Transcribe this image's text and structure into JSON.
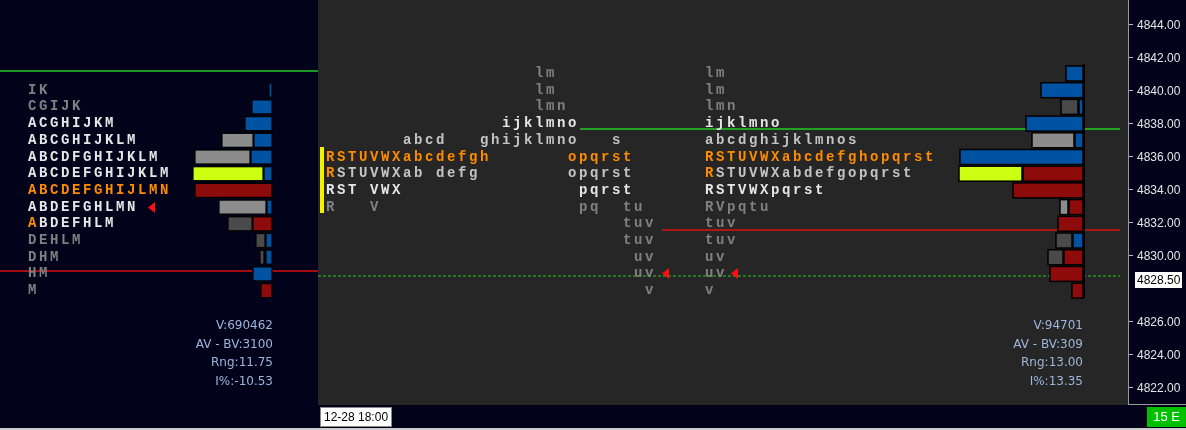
{
  "history_profile": {
    "rows": [
      {
        "parts": [
          {
            "text": "IK",
            "color": "#808080"
          }
        ],
        "marker": false
      },
      {
        "parts": [
          {
            "text": "CGIJK",
            "color": "#808080"
          }
        ],
        "marker": false
      },
      {
        "parts": [
          {
            "text": "ACGHIJKM",
            "color": "#e6e6e6"
          }
        ],
        "marker": false
      },
      {
        "parts": [
          {
            "text": "ABCGHIJKLM",
            "color": "#e6e6e6"
          }
        ],
        "marker": false
      },
      {
        "parts": [
          {
            "text": "ABCDFGHIJKLM",
            "color": "#e6e6e6"
          }
        ],
        "marker": false
      },
      {
        "parts": [
          {
            "text": "ABCDEFGHIJKLM",
            "color": "#e6e6e6"
          }
        ],
        "marker": false
      },
      {
        "parts": [
          {
            "text": "ABCDEFGHIJLMN",
            "color": "#ff8c00"
          }
        ],
        "marker": false
      },
      {
        "parts": [
          {
            "text": "ABDEFGHLMN",
            "color": "#e6e6e6"
          }
        ],
        "marker": true
      },
      {
        "parts": [
          {
            "text": "A",
            "color": "#ff8c00"
          },
          {
            "text": "BDEFHLM",
            "color": "#e6e6e6"
          }
        ],
        "marker": false
      },
      {
        "parts": [
          {
            "text": "DEHLM",
            "color": "#808080"
          }
        ],
        "marker": false
      },
      {
        "parts": [
          {
            "text": "DHM",
            "color": "#808080"
          }
        ],
        "marker": false
      },
      {
        "parts": [
          {
            "text": "HM",
            "color": "#808080"
          }
        ],
        "marker": false
      },
      {
        "parts": [
          {
            "text": "M",
            "color": "#808080"
          }
        ],
        "marker": false
      }
    ],
    "stats": [
      "V:690462",
      "AV - BV:3100",
      "Rng:11.75",
      "I%:-10.53"
    ]
  },
  "session_profile": {
    "rows": [
      {
        "cells": [
          {
            "parts": [
              {
                "text": "lm",
                "color": "#808080"
              }
            ]
          }
        ],
        "marker": false
      },
      {
        "cells": [
          {
            "parts": [
              {
                "text": "lm",
                "color": "#808080"
              }
            ]
          }
        ],
        "marker": false
      },
      {
        "cells": [
          {
            "parts": [
              {
                "text": "lmn",
                "color": "#808080"
              }
            ]
          }
        ],
        "marker": false
      },
      {
        "cells": [
          {
            "parts": [
              {
                "text": "ijklmno",
                "color": "#e6e6e6"
              }
            ]
          }
        ],
        "marker": false
      },
      {
        "cells": [
          {
            "parts": [
              {
                "text": "abcd",
                "color": "#c4c4c4"
              }
            ]
          },
          {
            "parts": [
              {
                "text": "ghijklmno",
                "color": "#c4c4c4"
              }
            ]
          },
          {
            "parts": [
              {
                "text": "s",
                "color": "#c4c4c4"
              }
            ]
          }
        ],
        "marker": false
      },
      {
        "cells": [
          {
            "parts": [
              {
                "text": "RSTUVWXabcdefgh",
                "color": "#ff8c00"
              }
            ]
          },
          {
            "parts": [
              {
                "text": "opqrst",
                "color": "#ff8c00"
              }
            ]
          }
        ],
        "marker": false
      },
      {
        "cells": [
          {
            "parts": [
              {
                "text": "R",
                "color": "#ff8c00"
              },
              {
                "text": "STUVWXab",
                "color": "#c4c4c4"
              }
            ]
          },
          {
            "parts": [
              {
                "text": "defg",
                "color": "#c4c4c4"
              }
            ]
          },
          {
            "parts": [
              {
                "text": "opqrst",
                "color": "#c4c4c4"
              }
            ]
          }
        ],
        "marker": false
      },
      {
        "cells": [
          {
            "parts": [
              {
                "text": "RST",
                "color": "#e6e6e6"
              }
            ]
          },
          {
            "parts": [
              {
                "text": "VWX",
                "color": "#e6e6e6"
              }
            ]
          },
          {
            "parts": [
              {
                "text": "pqrst",
                "color": "#e6e6e6"
              }
            ]
          }
        ],
        "marker": false
      },
      {
        "cells": [
          {
            "parts": [
              {
                "text": "R",
                "color": "#808080"
              }
            ]
          },
          {
            "parts": [
              {
                "text": "V",
                "color": "#808080"
              }
            ]
          },
          {
            "parts": [
              {
                "text": "pq",
                "color": "#808080"
              }
            ]
          },
          {
            "parts": [
              {
                "text": "tu",
                "color": "#808080"
              }
            ]
          }
        ],
        "marker": false
      },
      {
        "cells": [
          {
            "parts": [
              {
                "text": "tuv",
                "color": "#808080"
              }
            ]
          }
        ],
        "marker": false
      },
      {
        "cells": [
          {
            "parts": [
              {
                "text": "tuv",
                "color": "#808080"
              }
            ]
          }
        ],
        "marker": false
      },
      {
        "cells": [
          {
            "parts": [
              {
                "text": "uv",
                "color": "#808080"
              }
            ]
          }
        ],
        "marker": false
      },
      {
        "cells": [
          {
            "parts": [
              {
                "text": "uv",
                "color": "#808080"
              }
            ]
          }
        ],
        "marker": true
      },
      {
        "cells": [
          {
            "parts": [
              {
                "text": "v",
                "color": "#808080"
              }
            ]
          }
        ],
        "marker": false
      }
    ]
  },
  "composite_profile": {
    "rows": [
      {
        "parts": [
          {
            "text": "lm",
            "color": "#808080"
          }
        ],
        "marker": false
      },
      {
        "parts": [
          {
            "text": "lm",
            "color": "#808080"
          }
        ],
        "marker": false
      },
      {
        "parts": [
          {
            "text": "lmn",
            "color": "#808080"
          }
        ],
        "marker": false
      },
      {
        "parts": [
          {
            "text": "ijklmno",
            "color": "#e6e6e6"
          }
        ],
        "marker": false
      },
      {
        "parts": [
          {
            "text": "abcdghijklmnos",
            "color": "#c4c4c4"
          }
        ],
        "marker": false
      },
      {
        "parts": [
          {
            "text": "RSTUVWXabcdefghopqrst",
            "color": "#ff8c00"
          }
        ],
        "marker": false
      },
      {
        "parts": [
          {
            "text": "R",
            "color": "#ff8c00"
          },
          {
            "text": "STUVWXabdefgopqrst",
            "color": "#c4c4c4"
          }
        ],
        "marker": false
      },
      {
        "parts": [
          {
            "text": "RSTVWXpqrst",
            "color": "#e6e6e6"
          }
        ],
        "marker": false
      },
      {
        "parts": [
          {
            "text": "RVpqtu",
            "color": "#808080"
          }
        ],
        "marker": false
      },
      {
        "parts": [
          {
            "text": "tuv",
            "color": "#808080"
          }
        ],
        "marker": false
      },
      {
        "parts": [
          {
            "text": "tuv",
            "color": "#808080"
          }
        ],
        "marker": false
      },
      {
        "parts": [
          {
            "text": "uv",
            "color": "#808080"
          }
        ],
        "marker": false
      },
      {
        "parts": [
          {
            "text": "uv",
            "color": "#808080"
          }
        ],
        "marker": true
      },
      {
        "parts": [
          {
            "text": "v",
            "color": "#808080"
          }
        ],
        "marker": false
      }
    ],
    "stats": [
      "V:94701",
      "AV - BV:309",
      "Rng:13.00",
      "I%:13.35"
    ]
  },
  "price_axis": {
    "labels": [
      "4844.00",
      "4842.00",
      "4840.00",
      "4838.00",
      "4836.00",
      "4834.00",
      "4832.00",
      "4830.00",
      "4826.00",
      "4824.00",
      "4822.00"
    ],
    "current_price": "4828.50"
  },
  "time_axis": {
    "cursor_label": "12-28  18:00"
  },
  "status_badge": "15 E"
}
